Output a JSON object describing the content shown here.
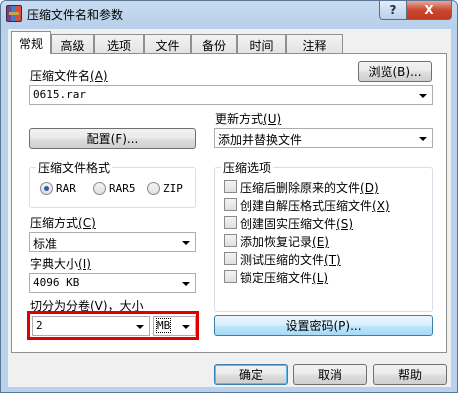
{
  "window": {
    "title": "压缩文件名和参数",
    "help_btn": "?",
    "close_btn": "X"
  },
  "tabs": [
    "常规",
    "高级",
    "选项",
    "文件",
    "备份",
    "时间",
    "注释"
  ],
  "archive_name": {
    "label": "压缩文件名",
    "hotkey": "(A)",
    "value": "0615.rar",
    "browse_button": "浏览(B)..."
  },
  "update_mode": {
    "label": "更新方式",
    "hotkey": "(U)",
    "value": "添加并替换文件"
  },
  "profiles_button": "配置(F)...",
  "archive_format": {
    "title": "压缩文件格式",
    "options": [
      "RAR",
      "RAR5",
      "ZIP"
    ],
    "selected": "RAR"
  },
  "archive_options": {
    "title": "压缩选项",
    "items": [
      {
        "label": "压缩后删除原来的文件",
        "hotkey": "(D)",
        "checked": false
      },
      {
        "label": "创建自解压格式压缩文件",
        "hotkey": "(X)",
        "checked": false
      },
      {
        "label": "创建固实压缩文件",
        "hotkey": "(S)",
        "checked": false
      },
      {
        "label": "添加恢复记录",
        "hotkey": "(E)",
        "checked": false
      },
      {
        "label": "测试压缩的文件",
        "hotkey": "(T)",
        "checked": false
      },
      {
        "label": "锁定压缩文件",
        "hotkey": "(L)",
        "checked": false
      }
    ]
  },
  "compression_method": {
    "label": "压缩方式",
    "hotkey": "(C)",
    "value": "标准"
  },
  "dictionary_size": {
    "label": "字典大小",
    "hotkey": "(I)",
    "value": "4096 KB"
  },
  "split_volumes": {
    "label": "切分为分卷(V)，大小",
    "value": "2",
    "unit": "MB"
  },
  "set_password_button": "设置密码(P)...",
  "footer": {
    "ok": "确定",
    "cancel": "取消",
    "help": "帮助"
  },
  "colors": {
    "highlight_box": "#e00000",
    "title_bar": "#b9d1ea",
    "close_button": "#c9492f"
  },
  "icons": {
    "app": "winrar-books-icon",
    "help": "question-mark-icon",
    "close": "close-x-icon",
    "dropdown": "chevron-down-icon"
  }
}
